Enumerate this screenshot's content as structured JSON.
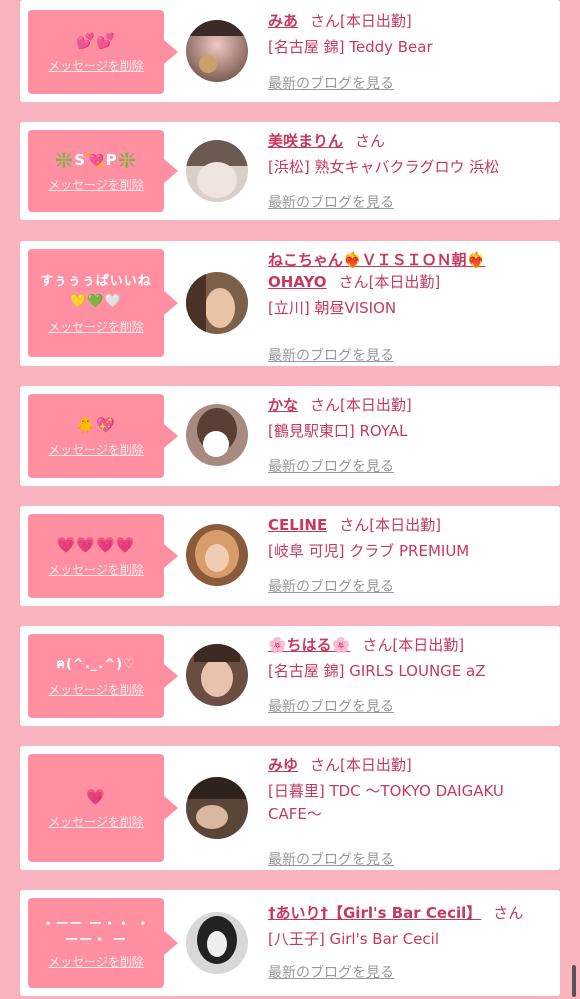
{
  "delete_label": "メッセージを削除",
  "blog_label": "最新のブログを見る",
  "san_label": "さん",
  "colors": {
    "page_bg": "#f9b3bf",
    "bubble": "#ff8fa1",
    "name": "#c8385e",
    "link_gray": "#999999"
  },
  "items": [
    {
      "message": "💕💕",
      "name": "みあ",
      "suffix": "[本日出勤]",
      "shop": "[名古屋 錦] Teddy Bear",
      "avatar_icon": "avatar-photo"
    },
    {
      "message": "❇️S💘P❇️",
      "name": "美咲まりん",
      "suffix": "",
      "shop": "[浜松] 熟女キャバクラグロウ 浜松",
      "avatar_icon": "avatar-photo"
    },
    {
      "message": "すぅぅぅぱいいね💛💚🤍",
      "name": "ねこちゃん❤️‍🔥ＶＩＳＩＯＮ朝❤️‍🔥OHAYO",
      "suffix": "[本日出勤]",
      "shop": "[立川] 朝昼VISION",
      "avatar_icon": "avatar-photo"
    },
    {
      "message": "🐥💖",
      "name": "かな",
      "suffix": "[本日出勤]",
      "shop": "[鶴見駅東口] ROYAL",
      "avatar_icon": "avatar-photo"
    },
    {
      "message": "💗💗💗💗",
      "name": "CELINE",
      "suffix": "[本日出勤]",
      "shop": "[岐阜 可児] クラブ PREMIUM",
      "avatar_icon": "avatar-photo"
    },
    {
      "message": "ฅ(^._.^)♡",
      "name": "🌸ちはる🌸",
      "suffix": "[本日出勤]",
      "shop": "[名古屋 錦] GIRLS LOUNGE aZ",
      "avatar_icon": "avatar-photo"
    },
    {
      "message": "💗",
      "name": "みゆ",
      "suffix": "[本日出勤]",
      "shop": "[日暮里] TDC 〜TOKYO DAIGAKU CAFE〜",
      "avatar_icon": "avatar-photo"
    },
    {
      "message": "・ーー ー・・ ・ーー・ ー",
      "name": "†あいり†【Girl's Bar Cecil】",
      "suffix": "",
      "shop": "[八王子] Girl's Bar Cecil",
      "avatar_icon": "avatar-photo"
    }
  ]
}
